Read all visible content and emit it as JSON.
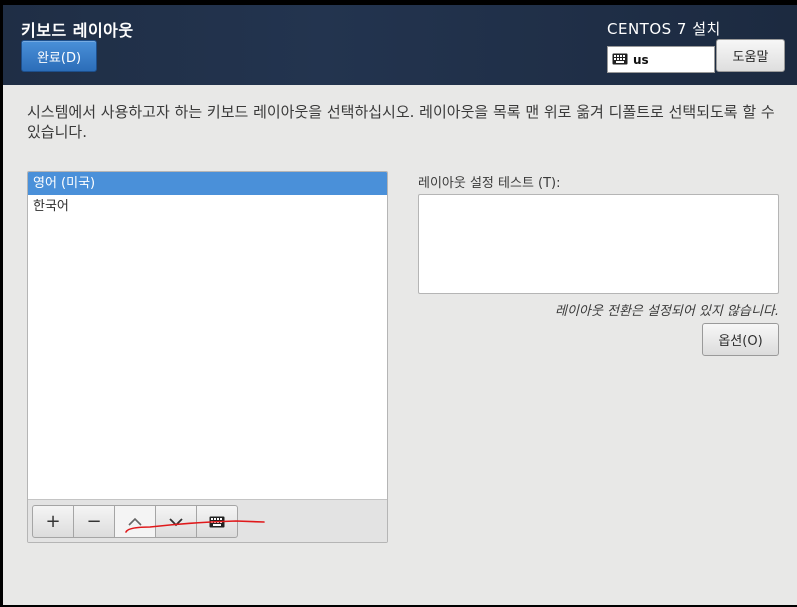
{
  "header": {
    "title": "키보드 레이아웃",
    "done_label": "완료(D)",
    "install_title": "CENTOS 7 설치",
    "keyboard_indicator": {
      "icon": "keyboard-icon",
      "value": "us"
    },
    "help_label": "도움말"
  },
  "main": {
    "description": "시스템에서 사용하고자 하는 키보드 레이아웃을 선택하십시오. 레이아웃을 목록 맨 위로 옮겨 디폴트로 선택되도록 할 수 있습니다.",
    "layouts": [
      {
        "label": "영어 (미국)",
        "selected": true
      },
      {
        "label": "한국어",
        "selected": false
      }
    ],
    "toolbar": {
      "add": "+",
      "remove": "−",
      "move_up_icon": "chevron-up-icon",
      "move_down_icon": "chevron-down-icon",
      "preview_icon": "keyboard-icon"
    },
    "test_label": "레이아웃 설정 테스트 (T):",
    "test_value": "",
    "switch_note": "레이아웃 전환은 설정되어 있지 않습니다.",
    "options_label": "옵션(O)"
  },
  "colors": {
    "header_bg": "#1f2e45",
    "accent": "#4a90d9",
    "annotation_stroke": "#e0191b"
  }
}
